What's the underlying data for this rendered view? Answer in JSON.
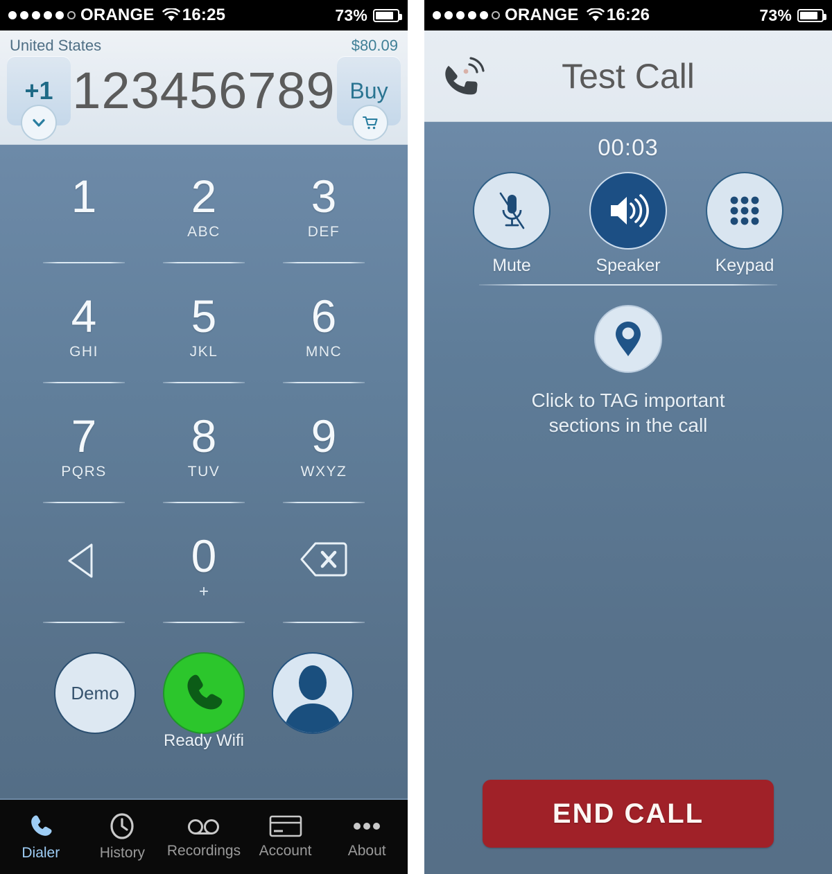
{
  "colors": {
    "accent_blue": "#1c4f84",
    "panel_bg_top": "#6d8aa8",
    "panel_bg_bottom": "#536d85",
    "call_green": "#2cc62c",
    "end_call_red": "#a02128",
    "header_light": "#e7edf3",
    "tab_active": "#9ecdf5"
  },
  "dialer": {
    "status_bar": {
      "carrier": "ORANGE",
      "signal_dots_filled": 5,
      "signal_dots_empty": 1,
      "wifi_icon": "wifi-icon",
      "time": "16:25",
      "battery_percent": "73%",
      "battery_level": 73
    },
    "header": {
      "country": "United States",
      "balance": "$80.09",
      "country_code_label": "+1",
      "chevron_icon": "chevron-down-icon",
      "buy_label": "Buy",
      "cart_icon": "shopping-cart-icon",
      "number": "123456789"
    },
    "keypad": [
      {
        "digit": "1",
        "letters": ""
      },
      {
        "digit": "2",
        "letters": "ABC"
      },
      {
        "digit": "3",
        "letters": "DEF"
      },
      {
        "digit": "4",
        "letters": "GHI"
      },
      {
        "digit": "5",
        "letters": "JKL"
      },
      {
        "digit": "6",
        "letters": "MNC"
      },
      {
        "digit": "7",
        "letters": "PQRS"
      },
      {
        "digit": "8",
        "letters": "TUV"
      },
      {
        "digit": "9",
        "letters": "WXYZ"
      },
      {
        "digit": "",
        "letters": "",
        "icon": "play-back-triangle-icon"
      },
      {
        "digit": "0",
        "letters": "+"
      },
      {
        "digit": "",
        "letters": "",
        "icon": "backspace-icon"
      }
    ],
    "actions": {
      "demo_label": "Demo",
      "call_icon": "phone-handset-icon",
      "contacts_icon": "contact-avatar-icon",
      "status_label": "Ready Wifi"
    },
    "tabs": [
      {
        "label": "Dialer",
        "icon": "phone-handset-icon",
        "active": true
      },
      {
        "label": "History",
        "icon": "clock-icon",
        "active": false
      },
      {
        "label": "Recordings",
        "icon": "voicemail-icon",
        "active": false
      },
      {
        "label": "Account",
        "icon": "credit-card-icon",
        "active": false
      },
      {
        "label": "About",
        "icon": "ellipsis-icon",
        "active": false
      }
    ]
  },
  "incall": {
    "status_bar": {
      "carrier": "ORANGE",
      "signal_dots_filled": 5,
      "signal_dots_empty": 1,
      "wifi_icon": "wifi-icon",
      "time": "16:26",
      "battery_percent": "73%",
      "battery_level": 73
    },
    "header": {
      "title": "Test Call",
      "icon": "ringing-phone-icon"
    },
    "timer": "00:03",
    "controls": [
      {
        "label": "Mute",
        "icon": "microphone-muted-icon",
        "state": "off"
      },
      {
        "label": "Speaker",
        "icon": "speaker-loud-icon",
        "state": "on"
      },
      {
        "label": "Keypad",
        "icon": "keypad-grid-icon",
        "state": "off"
      }
    ],
    "tag": {
      "icon": "map-pin-icon",
      "text_line1": "Click to TAG important",
      "text_line2": "sections in the call"
    },
    "end_call_label": "END CALL"
  }
}
